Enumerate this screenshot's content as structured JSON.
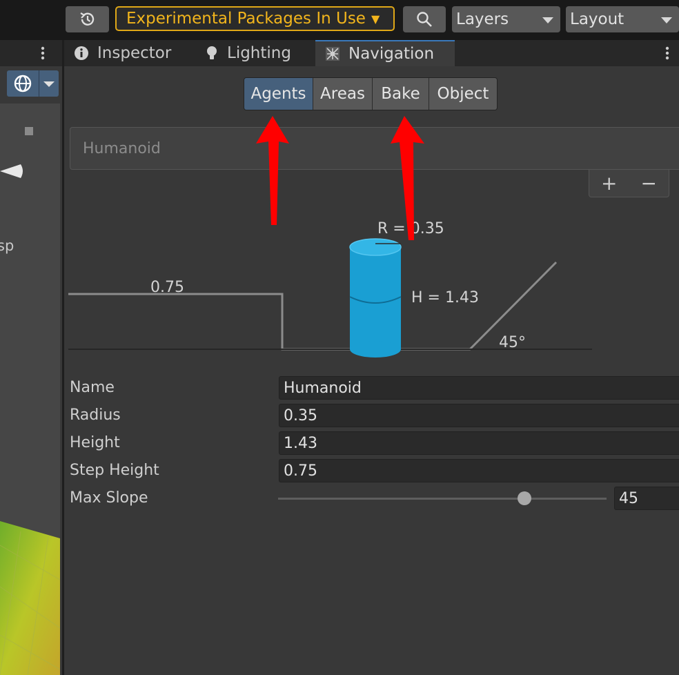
{
  "toolbar": {
    "experimental_label": "Experimental Packages In Use",
    "layers_label": "Layers",
    "layout_label": "Layout"
  },
  "scene": {
    "partial_label": "sp"
  },
  "tabs": [
    {
      "label": "Inspector",
      "icon": "info-icon"
    },
    {
      "label": "Lighting",
      "icon": "lightbulb-icon"
    },
    {
      "label": "Navigation",
      "icon": "navigation-icon",
      "active": true
    }
  ],
  "segments": [
    "Agents",
    "Areas",
    "Bake",
    "Object"
  ],
  "selected_segment": "Agents",
  "agent_list": {
    "selected": "Humanoid"
  },
  "diagram": {
    "radius_label": "R = 0.35",
    "height_label": "H = 1.43",
    "step_label": "0.75",
    "slope_label": "45°"
  },
  "form": {
    "name_label": "Name",
    "name_value": "Humanoid",
    "radius_label": "Radius",
    "radius_value": "0.35",
    "height_label": "Height",
    "height_value": "1.43",
    "step_label": "Step Height",
    "step_value": "0.75",
    "slope_label": "Max Slope",
    "slope_value": "45",
    "slope_slider_fraction": 0.75
  },
  "colors": {
    "accent_tab": "#3a79bb",
    "active_segment": "#46607c",
    "warning": "#f2b51c",
    "cylinder": "#1a9fd3",
    "annotation_arrow": "#ff0000"
  }
}
